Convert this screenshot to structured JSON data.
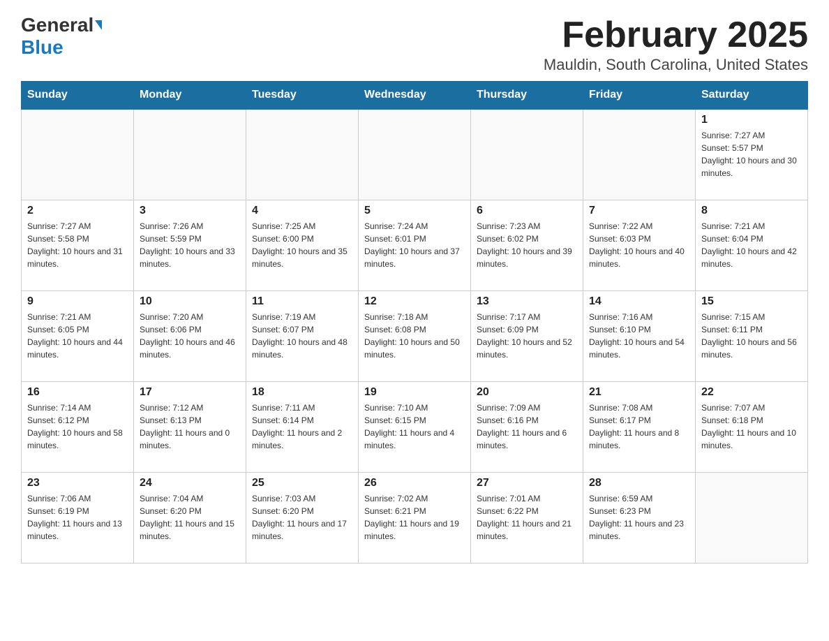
{
  "header": {
    "logo_general": "General",
    "logo_blue": "Blue",
    "title": "February 2025",
    "subtitle": "Mauldin, South Carolina, United States"
  },
  "weekdays": [
    "Sunday",
    "Monday",
    "Tuesday",
    "Wednesday",
    "Thursday",
    "Friday",
    "Saturday"
  ],
  "weeks": [
    [
      {
        "day": "",
        "sunrise": "",
        "sunset": "",
        "daylight": ""
      },
      {
        "day": "",
        "sunrise": "",
        "sunset": "",
        "daylight": ""
      },
      {
        "day": "",
        "sunrise": "",
        "sunset": "",
        "daylight": ""
      },
      {
        "day": "",
        "sunrise": "",
        "sunset": "",
        "daylight": ""
      },
      {
        "day": "",
        "sunrise": "",
        "sunset": "",
        "daylight": ""
      },
      {
        "day": "",
        "sunrise": "",
        "sunset": "",
        "daylight": ""
      },
      {
        "day": "1",
        "sunrise": "Sunrise: 7:27 AM",
        "sunset": "Sunset: 5:57 PM",
        "daylight": "Daylight: 10 hours and 30 minutes."
      }
    ],
    [
      {
        "day": "2",
        "sunrise": "Sunrise: 7:27 AM",
        "sunset": "Sunset: 5:58 PM",
        "daylight": "Daylight: 10 hours and 31 minutes."
      },
      {
        "day": "3",
        "sunrise": "Sunrise: 7:26 AM",
        "sunset": "Sunset: 5:59 PM",
        "daylight": "Daylight: 10 hours and 33 minutes."
      },
      {
        "day": "4",
        "sunrise": "Sunrise: 7:25 AM",
        "sunset": "Sunset: 6:00 PM",
        "daylight": "Daylight: 10 hours and 35 minutes."
      },
      {
        "day": "5",
        "sunrise": "Sunrise: 7:24 AM",
        "sunset": "Sunset: 6:01 PM",
        "daylight": "Daylight: 10 hours and 37 minutes."
      },
      {
        "day": "6",
        "sunrise": "Sunrise: 7:23 AM",
        "sunset": "Sunset: 6:02 PM",
        "daylight": "Daylight: 10 hours and 39 minutes."
      },
      {
        "day": "7",
        "sunrise": "Sunrise: 7:22 AM",
        "sunset": "Sunset: 6:03 PM",
        "daylight": "Daylight: 10 hours and 40 minutes."
      },
      {
        "day": "8",
        "sunrise": "Sunrise: 7:21 AM",
        "sunset": "Sunset: 6:04 PM",
        "daylight": "Daylight: 10 hours and 42 minutes."
      }
    ],
    [
      {
        "day": "9",
        "sunrise": "Sunrise: 7:21 AM",
        "sunset": "Sunset: 6:05 PM",
        "daylight": "Daylight: 10 hours and 44 minutes."
      },
      {
        "day": "10",
        "sunrise": "Sunrise: 7:20 AM",
        "sunset": "Sunset: 6:06 PM",
        "daylight": "Daylight: 10 hours and 46 minutes."
      },
      {
        "day": "11",
        "sunrise": "Sunrise: 7:19 AM",
        "sunset": "Sunset: 6:07 PM",
        "daylight": "Daylight: 10 hours and 48 minutes."
      },
      {
        "day": "12",
        "sunrise": "Sunrise: 7:18 AM",
        "sunset": "Sunset: 6:08 PM",
        "daylight": "Daylight: 10 hours and 50 minutes."
      },
      {
        "day": "13",
        "sunrise": "Sunrise: 7:17 AM",
        "sunset": "Sunset: 6:09 PM",
        "daylight": "Daylight: 10 hours and 52 minutes."
      },
      {
        "day": "14",
        "sunrise": "Sunrise: 7:16 AM",
        "sunset": "Sunset: 6:10 PM",
        "daylight": "Daylight: 10 hours and 54 minutes."
      },
      {
        "day": "15",
        "sunrise": "Sunrise: 7:15 AM",
        "sunset": "Sunset: 6:11 PM",
        "daylight": "Daylight: 10 hours and 56 minutes."
      }
    ],
    [
      {
        "day": "16",
        "sunrise": "Sunrise: 7:14 AM",
        "sunset": "Sunset: 6:12 PM",
        "daylight": "Daylight: 10 hours and 58 minutes."
      },
      {
        "day": "17",
        "sunrise": "Sunrise: 7:12 AM",
        "sunset": "Sunset: 6:13 PM",
        "daylight": "Daylight: 11 hours and 0 minutes."
      },
      {
        "day": "18",
        "sunrise": "Sunrise: 7:11 AM",
        "sunset": "Sunset: 6:14 PM",
        "daylight": "Daylight: 11 hours and 2 minutes."
      },
      {
        "day": "19",
        "sunrise": "Sunrise: 7:10 AM",
        "sunset": "Sunset: 6:15 PM",
        "daylight": "Daylight: 11 hours and 4 minutes."
      },
      {
        "day": "20",
        "sunrise": "Sunrise: 7:09 AM",
        "sunset": "Sunset: 6:16 PM",
        "daylight": "Daylight: 11 hours and 6 minutes."
      },
      {
        "day": "21",
        "sunrise": "Sunrise: 7:08 AM",
        "sunset": "Sunset: 6:17 PM",
        "daylight": "Daylight: 11 hours and 8 minutes."
      },
      {
        "day": "22",
        "sunrise": "Sunrise: 7:07 AM",
        "sunset": "Sunset: 6:18 PM",
        "daylight": "Daylight: 11 hours and 10 minutes."
      }
    ],
    [
      {
        "day": "23",
        "sunrise": "Sunrise: 7:06 AM",
        "sunset": "Sunset: 6:19 PM",
        "daylight": "Daylight: 11 hours and 13 minutes."
      },
      {
        "day": "24",
        "sunrise": "Sunrise: 7:04 AM",
        "sunset": "Sunset: 6:20 PM",
        "daylight": "Daylight: 11 hours and 15 minutes."
      },
      {
        "day": "25",
        "sunrise": "Sunrise: 7:03 AM",
        "sunset": "Sunset: 6:20 PM",
        "daylight": "Daylight: 11 hours and 17 minutes."
      },
      {
        "day": "26",
        "sunrise": "Sunrise: 7:02 AM",
        "sunset": "Sunset: 6:21 PM",
        "daylight": "Daylight: 11 hours and 19 minutes."
      },
      {
        "day": "27",
        "sunrise": "Sunrise: 7:01 AM",
        "sunset": "Sunset: 6:22 PM",
        "daylight": "Daylight: 11 hours and 21 minutes."
      },
      {
        "day": "28",
        "sunrise": "Sunrise: 6:59 AM",
        "sunset": "Sunset: 6:23 PM",
        "daylight": "Daylight: 11 hours and 23 minutes."
      },
      {
        "day": "",
        "sunrise": "",
        "sunset": "",
        "daylight": ""
      }
    ]
  ]
}
